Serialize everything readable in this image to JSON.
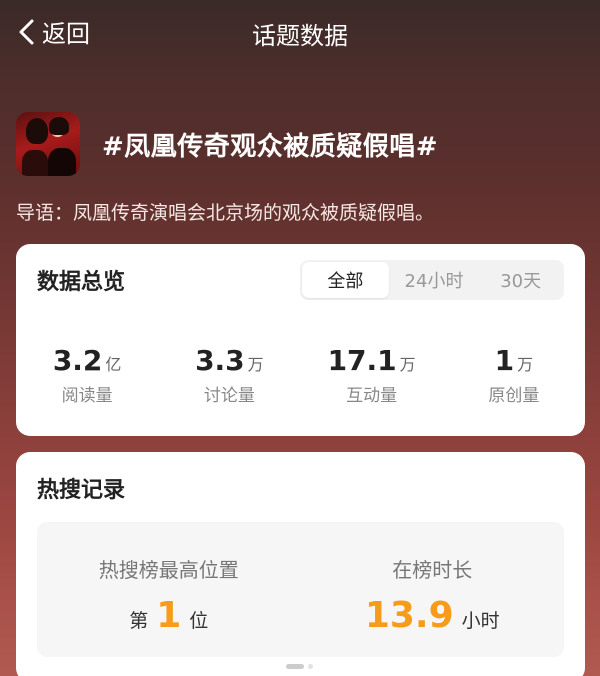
{
  "header": {
    "back_label": "返回",
    "title": "话题数据"
  },
  "topic": {
    "title": "#凤凰传奇观众被质疑假唱#",
    "intro": "导语：凤凰传奇演唱会北京场的观众被质疑假唱。"
  },
  "overview": {
    "title": "数据总览",
    "tabs": [
      "全部",
      "24小时",
      "30天"
    ],
    "active_tab": "全部",
    "stats": [
      {
        "value": "3.2",
        "unit": "亿",
        "label": "阅读量"
      },
      {
        "value": "3.3",
        "unit": "万",
        "label": "讨论量"
      },
      {
        "value": "17.1",
        "unit": "万",
        "label": "互动量"
      },
      {
        "value": "1",
        "unit": "万",
        "label": "原创量"
      }
    ]
  },
  "hot_search": {
    "title": "热搜记录",
    "highest": {
      "label": "热搜榜最高位置",
      "prefix": "第",
      "value": "1",
      "suffix": "位"
    },
    "duration": {
      "label": "在榜时长",
      "value": "13.9",
      "suffix": "小时"
    },
    "accent_color": "#f79b1a"
  }
}
